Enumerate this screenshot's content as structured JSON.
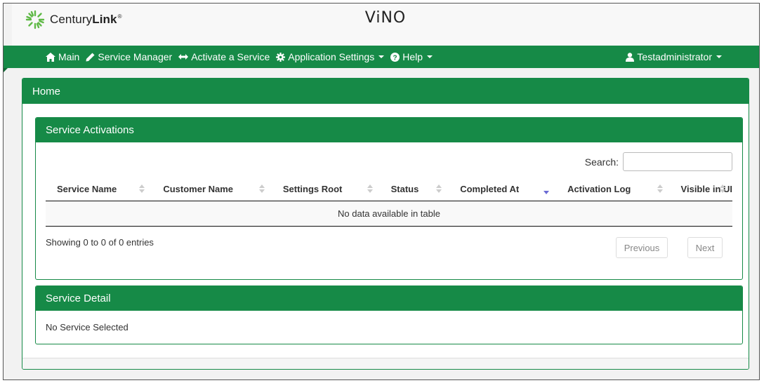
{
  "brand": {
    "logo_text_light": "Century",
    "logo_text_bold": "Link",
    "logo_mark": "®",
    "app_title": "ViNO"
  },
  "nav": {
    "items": [
      {
        "label": "Main",
        "icon": "home-icon"
      },
      {
        "label": "Service Manager",
        "icon": "pencil-icon"
      },
      {
        "label": "Activate a Service",
        "icon": "left-right-arrow-icon"
      },
      {
        "label": "Application Settings",
        "icon": "gear-icon"
      },
      {
        "label": "Help",
        "icon": "question-circle-icon"
      }
    ],
    "user": {
      "label": "Testadministrator",
      "icon": "user-icon"
    },
    "colors": {
      "primary": "#168a47"
    }
  },
  "home": {
    "title": "Home"
  },
  "service_activations": {
    "title": "Service Activations",
    "search": {
      "label": "Search:",
      "value": "",
      "placeholder": ""
    },
    "columns": [
      "Service Name",
      "Customer Name",
      "Settings Root",
      "Status",
      "Completed At",
      "Activation Log",
      "Visible in UI"
    ],
    "sorted_column": "Completed At",
    "sort_direction": "descending",
    "empty_message": "No data available in table",
    "info": "Showing 0 to 0 of 0 entries",
    "pagination": {
      "previous": "Previous",
      "next": "Next"
    }
  },
  "service_detail": {
    "title": "Service Detail",
    "body": "No Service Selected"
  }
}
